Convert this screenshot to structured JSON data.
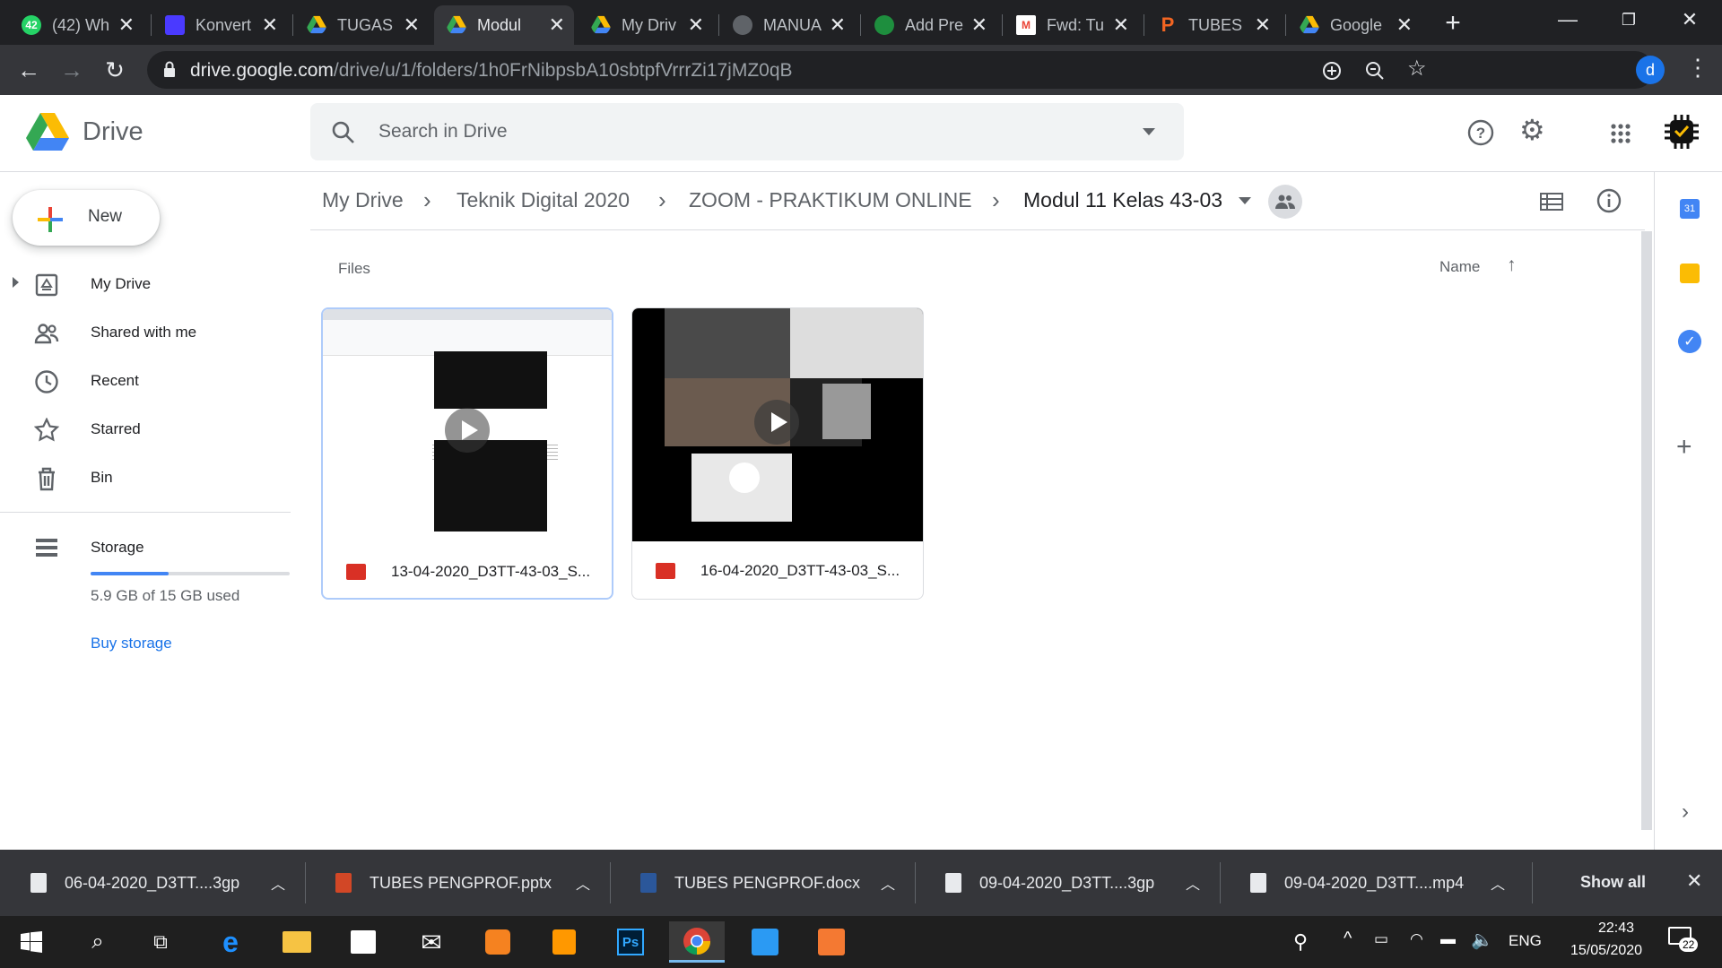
{
  "tabs": [
    {
      "title": "(42) Wh",
      "badge": "42",
      "favicon": "whatsapp-icon",
      "color": "#25d366"
    },
    {
      "title": "Konvert",
      "favicon": "video-converter-icon",
      "color": "#7b61ff"
    },
    {
      "title": "TUGAS",
      "favicon": "google-drive-icon",
      "color": "#fbbc04"
    },
    {
      "title": "Modul",
      "favicon": "google-drive-icon",
      "color": "#fbbc04",
      "active": true
    },
    {
      "title": "My Driv",
      "favicon": "google-drive-icon",
      "color": "#fbbc04"
    },
    {
      "title": "MANUA",
      "favicon": "globe-icon",
      "color": "#9aa0a6"
    },
    {
      "title": "Add Pre",
      "favicon": "settings-icon",
      "color": "#34a853"
    },
    {
      "title": "Fwd: Tu",
      "favicon": "gmail-icon",
      "color": "#ea4335"
    },
    {
      "title": "TUBES",
      "favicon": "p-logo-icon",
      "color": "#f26522"
    },
    {
      "title": "Google",
      "favicon": "google-drive-icon",
      "color": "#fbbc04"
    }
  ],
  "address": {
    "host": "drive.google.com",
    "path": "/drive/u/1/folders/1h0FrNibpsbA10sbtpfVrrrZi17jMZ0qB",
    "profile_initial": "d"
  },
  "drive": {
    "product": "Drive",
    "search_placeholder": "Search in Drive",
    "new_label": "New",
    "nav": [
      {
        "label": "My Drive",
        "icon": "my-drive-icon"
      },
      {
        "label": "Shared with me",
        "icon": "shared-icon"
      },
      {
        "label": "Recent",
        "icon": "clock-icon"
      },
      {
        "label": "Starred",
        "icon": "star-icon"
      },
      {
        "label": "Bin",
        "icon": "trash-icon"
      }
    ],
    "storage_label": "Storage",
    "storage_used_text": "5.9 GB of 15 GB used",
    "storage_fraction": 0.39,
    "buy_storage": "Buy storage",
    "breadcrumb": [
      "My Drive",
      "Teknik Digital 2020",
      "ZOOM - PRAKTIKUM ONLINE",
      "Modul 11 Kelas 43-03"
    ],
    "section_label": "Files",
    "sort_label": "Name",
    "files": [
      {
        "name": "13-04-2020_D3TT-43-03_S...",
        "selected": true
      },
      {
        "name": "16-04-2020_D3TT-43-03_S..."
      }
    ],
    "right_panel": {
      "calendar_day": "31"
    }
  },
  "downloads": [
    {
      "name": "06-04-2020_D3TT....3gp"
    },
    {
      "name": "TUBES PENGPROF.pptx"
    },
    {
      "name": "TUBES PENGPROF.docx"
    },
    {
      "name": "09-04-2020_D3TT....3gp"
    },
    {
      "name": "09-04-2020_D3TT....mp4"
    }
  ],
  "downloads_show_all": "Show all",
  "taskbar": {
    "language": "ENG",
    "time": "22:43",
    "date": "15/05/2020",
    "notification_count": "22"
  }
}
